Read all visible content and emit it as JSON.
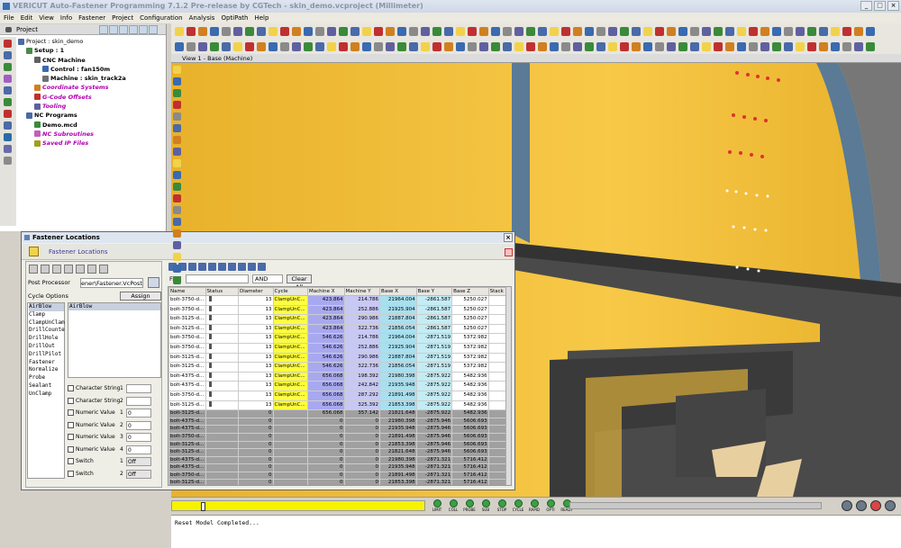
{
  "window": {
    "title": "VERICUT Auto-Fastener Programming 7.1.2 Pre-release by CGTech - skin_demo.vcproject (Millimeter)"
  },
  "menu": [
    "File",
    "Edit",
    "View",
    "Info",
    "Fastener",
    "Project",
    "Configuration",
    "Analysis",
    "OptiPath",
    "Help"
  ],
  "project": {
    "header": "Project",
    "tree": [
      {
        "label": "Project : skin_demo",
        "indent": 0,
        "style": "normal",
        "icon_color": "#4a6aa8"
      },
      {
        "label": "Setup : 1",
        "indent": 1,
        "style": "bold",
        "icon_color": "#4a8a4a"
      },
      {
        "label": "CNC Machine",
        "indent": 2,
        "style": "bold",
        "icon_color": "#606060"
      },
      {
        "label": "Control : fan150m",
        "indent": 3,
        "style": "bold",
        "icon_color": "#3a6ab0"
      },
      {
        "label": "Machine : skin_track2a",
        "indent": 3,
        "style": "bold",
        "icon_color": "#707070"
      },
      {
        "label": "Coordinate Systems",
        "indent": 2,
        "style": "link",
        "icon_color": "#d08020"
      },
      {
        "label": "G-Code Offsets",
        "indent": 2,
        "style": "link",
        "icon_color": "#c03030"
      },
      {
        "label": "Tooling",
        "indent": 2,
        "style": "link",
        "icon_color": "#6060a0"
      },
      {
        "label": "NC Programs",
        "indent": 1,
        "style": "bold",
        "icon_color": "#4a6aa8"
      },
      {
        "label": "Demo.mcd",
        "indent": 2,
        "style": "bold",
        "icon_color": "#3a8a3a"
      },
      {
        "label": "NC Subroutines",
        "indent": 2,
        "style": "link",
        "icon_color": "#c060c0"
      },
      {
        "label": "Saved IP Files",
        "indent": 2,
        "style": "link",
        "icon_color": "#a0a020"
      }
    ]
  },
  "view": {
    "title": "View 1 - Base (Machine)"
  },
  "fastener_window": {
    "title": "Fastener Locations",
    "header_label": "Fastener Locations",
    "post_processor_label": "Post Processor",
    "post_processor_value": "ener\\Fastener.VcPost",
    "cycle_options_label": "Cycle Options",
    "assign_label": "Assign",
    "cycles": [
      "AirBlow",
      "Clamp",
      "ClampUnClam",
      "DrillCounte",
      "DrillHole",
      "DrillOut",
      "DrillPilot",
      "Fastener",
      "Normalize",
      "Probe",
      "Sealant",
      "UnClamp"
    ],
    "selected_cycle": "AirBlow",
    "params": [
      {
        "label": "Character String",
        "num": "1",
        "value": ""
      },
      {
        "label": "Character String",
        "num": "2",
        "value": ""
      },
      {
        "label": "Numeric Value",
        "num": "1",
        "value": "0"
      },
      {
        "label": "Numeric Value",
        "num": "2",
        "value": "0"
      },
      {
        "label": "Numeric Value",
        "num": "3",
        "value": "0"
      },
      {
        "label": "Numeric Value",
        "num": "4",
        "value": "0"
      },
      {
        "label": "Switch",
        "num": "1",
        "value": "Off"
      },
      {
        "label": "Switch",
        "num": "2",
        "value": "Off"
      }
    ],
    "find_label": "Find",
    "and_value": "AND",
    "clear_all_label": "Clear All",
    "columns": [
      "Name",
      "Status",
      "Diameter",
      "Cycle",
      "Machine X",
      "Machine Y",
      "Base X",
      "Base Y",
      "Base Z",
      "Stack"
    ],
    "rows": [
      {
        "name": "bolt-3750-d...",
        "d": "13",
        "cycle": "ClampUnC...",
        "mx": "423.864",
        "my": "214.786",
        "bx": "21964.004",
        "by": "-2861.587",
        "bz": "5250.027",
        "g": false
      },
      {
        "name": "bolt-3750-d...",
        "d": "13",
        "cycle": "ClampUnC...",
        "mx": "423.864",
        "my": "252.886",
        "bx": "21925.904",
        "by": "-2861.587",
        "bz": "5250.027",
        "g": false
      },
      {
        "name": "bolt-3125-d...",
        "d": "13",
        "cycle": "ClampUnC...",
        "mx": "423.864",
        "my": "290.986",
        "bx": "21887.804",
        "by": "-2861.587",
        "bz": "5250.027",
        "g": false
      },
      {
        "name": "bolt-3125-d...",
        "d": "13",
        "cycle": "ClampUnC...",
        "mx": "423.864",
        "my": "322.736",
        "bx": "21856.054",
        "by": "-2861.587",
        "bz": "5250.027",
        "g": false
      },
      {
        "name": "bolt-3750-d...",
        "d": "13",
        "cycle": "ClampUnC...",
        "mx": "546.626",
        "my": "214.786",
        "bx": "21964.004",
        "by": "-2871.519",
        "bz": "5372.982",
        "g": false
      },
      {
        "name": "bolt-3750-d...",
        "d": "13",
        "cycle": "ClampUnC...",
        "mx": "546.626",
        "my": "252.886",
        "bx": "21925.904",
        "by": "-2871.519",
        "bz": "5372.982",
        "g": false
      },
      {
        "name": "bolt-3125-d...",
        "d": "13",
        "cycle": "ClampUnC...",
        "mx": "546.626",
        "my": "290.986",
        "bx": "21887.804",
        "by": "-2871.519",
        "bz": "5372.982",
        "g": false
      },
      {
        "name": "bolt-3125-d...",
        "d": "13",
        "cycle": "ClampUnC...",
        "mx": "546.626",
        "my": "322.736",
        "bx": "21856.054",
        "by": "-2871.519",
        "bz": "5372.982",
        "g": false
      },
      {
        "name": "bolt-4375-d...",
        "d": "13",
        "cycle": "ClampUnC...",
        "mx": "656.068",
        "my": "198.392",
        "bx": "21980.398",
        "by": "-2875.922",
        "bz": "5482.936",
        "g": false
      },
      {
        "name": "bolt-4375-d...",
        "d": "13",
        "cycle": "ClampUnC...",
        "mx": "656.068",
        "my": "242.842",
        "bx": "21935.948",
        "by": "-2875.922",
        "bz": "5482.936",
        "g": false
      },
      {
        "name": "bolt-3750-d...",
        "d": "13",
        "cycle": "ClampUnC...",
        "mx": "656.068",
        "my": "287.292",
        "bx": "21891.498",
        "by": "-2875.922",
        "bz": "5482.936",
        "g": false
      },
      {
        "name": "bolt-3125-d...",
        "d": "13",
        "cycle": "ClampUnC...",
        "mx": "656.068",
        "my": "325.392",
        "bx": "21853.398",
        "by": "-2875.922",
        "bz": "5482.936",
        "g": false
      },
      {
        "name": "bolt-3125-d...",
        "d": "0",
        "cycle": "",
        "mx": "656.068",
        "my": "357.142",
        "bx": "21821.648",
        "by": "-2875.922",
        "bz": "5482.936",
        "g": true
      },
      {
        "name": "bolt-4375-d...",
        "d": "0",
        "cycle": "",
        "mx": "0",
        "my": "0",
        "bx": "21980.398",
        "by": "-2875.946",
        "bz": "5606.693",
        "g": true
      },
      {
        "name": "bolt-4375-d...",
        "d": "0",
        "cycle": "",
        "mx": "0",
        "my": "0",
        "bx": "21935.948",
        "by": "-2875.946",
        "bz": "5606.693",
        "g": true
      },
      {
        "name": "bolt-3750-d...",
        "d": "0",
        "cycle": "",
        "mx": "0",
        "my": "0",
        "bx": "21891.498",
        "by": "-2875.946",
        "bz": "5606.693",
        "g": true
      },
      {
        "name": "bolt-3125-d...",
        "d": "0",
        "cycle": "",
        "mx": "0",
        "my": "0",
        "bx": "21853.398",
        "by": "-2875.946",
        "bz": "5606.693",
        "g": true
      },
      {
        "name": "bolt-3125-d...",
        "d": "0",
        "cycle": "",
        "mx": "0",
        "my": "0",
        "bx": "21821.648",
        "by": "-2875.946",
        "bz": "5606.693",
        "g": true
      },
      {
        "name": "bolt-4375-d...",
        "d": "0",
        "cycle": "",
        "mx": "0",
        "my": "0",
        "bx": "21980.398",
        "by": "-2871.321",
        "bz": "5716.412",
        "g": true
      },
      {
        "name": "bolt-4375-d...",
        "d": "0",
        "cycle": "",
        "mx": "0",
        "my": "0",
        "bx": "21935.948",
        "by": "-2871.321",
        "bz": "5716.412",
        "g": true
      },
      {
        "name": "bolt-3750-d...",
        "d": "0",
        "cycle": "",
        "mx": "0",
        "my": "0",
        "bx": "21891.498",
        "by": "-2871.321",
        "bz": "5716.412",
        "g": true
      },
      {
        "name": "bolt-3125-d...",
        "d": "0",
        "cycle": "",
        "mx": "0",
        "my": "0",
        "bx": "21853.398",
        "by": "-2871.321",
        "bz": "5716.412",
        "g": true
      },
      {
        "name": "bolt-3125-d...",
        "d": "0",
        "cycle": "",
        "mx": "0",
        "my": "0",
        "bx": "21821.648",
        "by": "-2871.321",
        "bz": "5716.412",
        "g": true
      }
    ]
  },
  "status_leds": [
    "LIMIT",
    "COLL",
    "PROBE",
    "SUB",
    "STOP",
    "CYCLE",
    "RAPID",
    "OPTI",
    "READY"
  ],
  "log": {
    "text": "Reset Model Completed..."
  }
}
